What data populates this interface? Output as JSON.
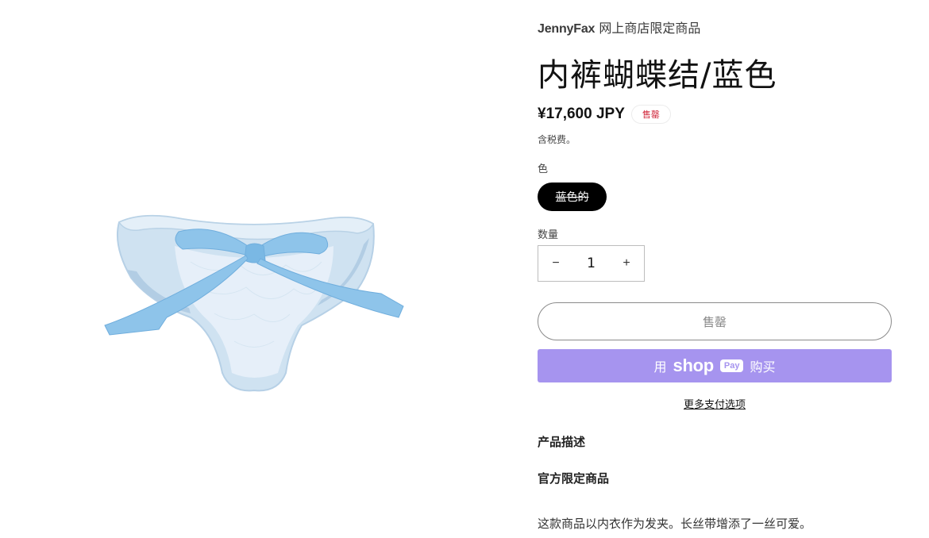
{
  "product": {
    "vendor_brand": "JennyFax",
    "vendor_suffix": "网上商店限定商品",
    "title": "内裤蝴蝶结/蓝色",
    "price": "¥17,600 JPY",
    "badge": "售罄",
    "tax_note": "含税费。",
    "color_label": "色",
    "color_option": "蓝色的",
    "quantity_label": "数量",
    "quantity_value": "1",
    "minus_symbol": "−",
    "plus_symbol": "+",
    "soldout_button": "售罄",
    "shop_pay": {
      "prefix": "用",
      "logo": "shop",
      "pay_tag": "Pay",
      "suffix": "购买"
    },
    "more_payment_options": "更多支付选项",
    "description_heading": "产品描述",
    "description_subheading": "官方限定商品",
    "description_body": "这款商品以内衣作为发夹。长丝带增添了一丝可爱。"
  },
  "colors": {
    "shop_pay_bg": "#a694ef",
    "badge_text": "#d0263a",
    "swatch_bg": "#000000"
  }
}
